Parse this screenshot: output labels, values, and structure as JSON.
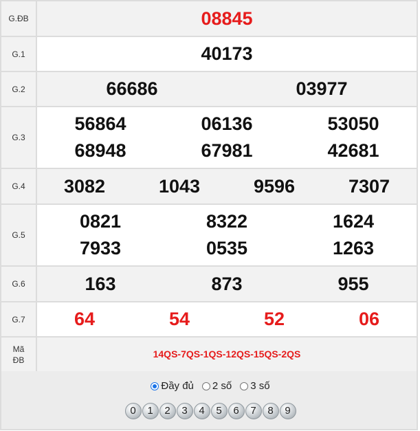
{
  "rows": {
    "gdb": {
      "label": "G.ĐB",
      "numbers": [
        "08845"
      ]
    },
    "g1": {
      "label": "G.1",
      "numbers": [
        "40173"
      ]
    },
    "g2": {
      "label": "G.2",
      "numbers": [
        "66686",
        "03977"
      ]
    },
    "g3": {
      "label": "G.3",
      "numbers": [
        "56864",
        "06136",
        "53050",
        "68948",
        "67981",
        "42681"
      ]
    },
    "g4": {
      "label": "G.4",
      "numbers": [
        "3082",
        "1043",
        "9596",
        "7307"
      ]
    },
    "g5": {
      "label": "G.5",
      "numbers": [
        "0821",
        "8322",
        "1624",
        "7933",
        "0535",
        "1263"
      ]
    },
    "g6": {
      "label": "G.6",
      "numbers": [
        "163",
        "873",
        "955"
      ]
    },
    "g7": {
      "label": "G.7",
      "numbers": [
        "64",
        "54",
        "52",
        "06"
      ]
    },
    "madb": {
      "label_line1": "Mã",
      "label_line2": "ĐB",
      "value": "14QS-7QS-1QS-12QS-15QS-2QS"
    }
  },
  "display_options": {
    "selected": "full",
    "full": "Đầy đủ",
    "two": "2 số",
    "three": "3 số"
  },
  "digit_filters": [
    "0",
    "1",
    "2",
    "3",
    "4",
    "5",
    "6",
    "7",
    "8",
    "9"
  ],
  "colors": {
    "highlight": "#e61c1c",
    "stripe": "#f2f2f2",
    "border": "#dcdcdc"
  }
}
